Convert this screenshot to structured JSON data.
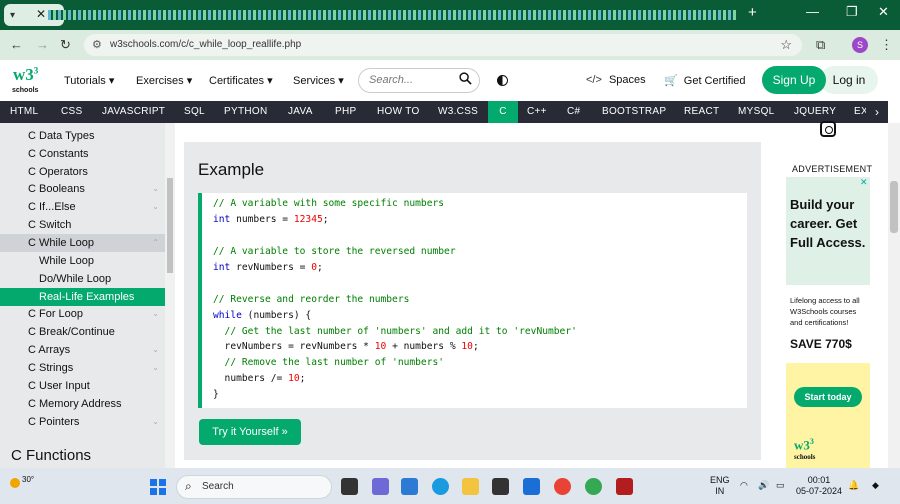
{
  "browser": {
    "url": "w3schools.com/c/c_while_loop_reallife.php",
    "profile_initial": "S"
  },
  "header": {
    "menu": [
      "Tutorials ▾",
      "Exercises ▾",
      "Certificates ▾",
      "Services ▾"
    ],
    "search_placeholder": "Search...",
    "spaces": "Spaces",
    "get_certified": "Get Certified",
    "sign_up": "Sign Up",
    "log_in": "Log in",
    "logo_text": "w3",
    "logo_sup": "3",
    "logo_sub": "schools"
  },
  "topnav": [
    "HTML",
    "CSS",
    "JAVASCRIPT",
    "SQL",
    "PYTHON",
    "JAVA",
    "PHP",
    "HOW TO",
    "W3.CSS",
    "C",
    "C++",
    "C#",
    "BOOTSTRAP",
    "REACT",
    "MYSQL",
    "JQUERY",
    "EX"
  ],
  "sidebar": {
    "items": [
      {
        "label": "C Data Types",
        "indent": false
      },
      {
        "label": "C Constants",
        "indent": false
      },
      {
        "label": "C Operators",
        "indent": false
      },
      {
        "label": "C Booleans",
        "indent": false
      },
      {
        "label": "C If...Else",
        "indent": false
      },
      {
        "label": "C Switch",
        "indent": false
      },
      {
        "label": "C While Loop",
        "indent": false
      },
      {
        "label": "While Loop",
        "indent": true
      },
      {
        "label": "Do/While Loop",
        "indent": true
      },
      {
        "label": "Real-Life Examples",
        "indent": true
      },
      {
        "label": "C For Loop",
        "indent": false
      },
      {
        "label": "C Break/Continue",
        "indent": false
      },
      {
        "label": "C Arrays",
        "indent": false
      },
      {
        "label": "C Strings",
        "indent": false
      },
      {
        "label": "C User Input",
        "indent": false
      },
      {
        "label": "C Memory Address",
        "indent": false
      },
      {
        "label": "C Pointers",
        "indent": false
      }
    ],
    "heading": "C Functions"
  },
  "example": {
    "title": "Example",
    "code": [
      [
        {
          "t": "// A variable with some specific numbers",
          "c": "comment"
        }
      ],
      [
        {
          "t": "int",
          "c": "key"
        },
        {
          "t": " numbers = ",
          "c": "txt"
        },
        {
          "t": "12345",
          "c": "num"
        },
        {
          "t": ";",
          "c": "txt"
        }
      ],
      [],
      [
        {
          "t": "// A variable to store the reversed number",
          "c": "comment"
        }
      ],
      [
        {
          "t": "int",
          "c": "key"
        },
        {
          "t": " revNumbers = ",
          "c": "txt"
        },
        {
          "t": "0",
          "c": "num"
        },
        {
          "t": ";",
          "c": "txt"
        }
      ],
      [],
      [
        {
          "t": "// Reverse and reorder the numbers",
          "c": "comment"
        }
      ],
      [
        {
          "t": "while",
          "c": "key"
        },
        {
          "t": " (numbers) {",
          "c": "txt"
        }
      ],
      [
        {
          "t": "  // Get the last number of 'numbers' and add it to 'revNumber'",
          "c": "comment"
        }
      ],
      [
        {
          "t": "  revNumbers = revNumbers * ",
          "c": "txt"
        },
        {
          "t": "10",
          "c": "num"
        },
        {
          "t": " + numbers % ",
          "c": "txt"
        },
        {
          "t": "10",
          "c": "num"
        },
        {
          "t": ";",
          "c": "txt"
        }
      ],
      [
        {
          "t": "  // Remove the last number of 'numbers'",
          "c": "comment"
        }
      ],
      [
        {
          "t": "  numbers /= ",
          "c": "txt"
        },
        {
          "t": "10",
          "c": "num"
        },
        {
          "t": ";",
          "c": "txt"
        }
      ],
      [
        {
          "t": "}",
          "c": "txt"
        }
      ]
    ],
    "try_button": "Try it Yourself »"
  },
  "ad": {
    "label": "ADVERTISEMENT",
    "headline": "Build your career. Get Full Access.",
    "body": "Lifelong access to all W3Schools courses and certifications!",
    "save": "SAVE 770$",
    "cta": "Start today",
    "logo": "w3",
    "logo_sup": "3",
    "logo_sub": "schools"
  },
  "taskbar": {
    "weather": "30°",
    "search": "Search",
    "lang": "ENG",
    "region": "IN",
    "time": "00:01",
    "date": "05-07-2024"
  },
  "colors": {
    "brand": "#04aa6d",
    "nav": "#282a35",
    "panel": "#e7e9eb",
    "tabstrip": "#0a5c36"
  }
}
